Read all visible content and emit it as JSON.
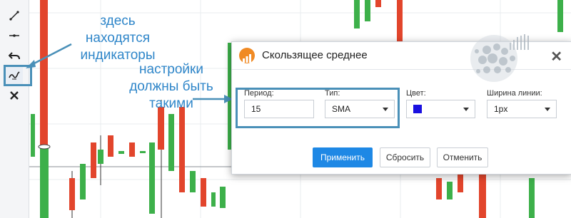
{
  "toolbar": {
    "items": [
      {
        "icon": "trend-line-icon"
      },
      {
        "icon": "horizontal-line-icon"
      },
      {
        "icon": "undo-icon"
      },
      {
        "icon": "indicator-icon",
        "active": true
      },
      {
        "icon": "close-icon"
      }
    ]
  },
  "annotations": {
    "toolbar_hint": "здесь находятся индикаторы",
    "settings_hint": "настройки должны быть такими"
  },
  "modal": {
    "title": "Скользящее среднее",
    "period": {
      "label": "Период:",
      "value": "15"
    },
    "type": {
      "label": "Тип:",
      "value": "SMA"
    },
    "color": {
      "label": "Цвет:",
      "value": "#1a10e0"
    },
    "line_width": {
      "label": "Ширина линии:",
      "value": "1px"
    },
    "buttons": {
      "apply": "Применить",
      "reset": "Сбросить",
      "cancel": "Отменить"
    }
  },
  "colors": {
    "bull": "#3db04a",
    "bear": "#e2452c",
    "accent": "#1e88e5",
    "annotation": "#2f86c9"
  }
}
